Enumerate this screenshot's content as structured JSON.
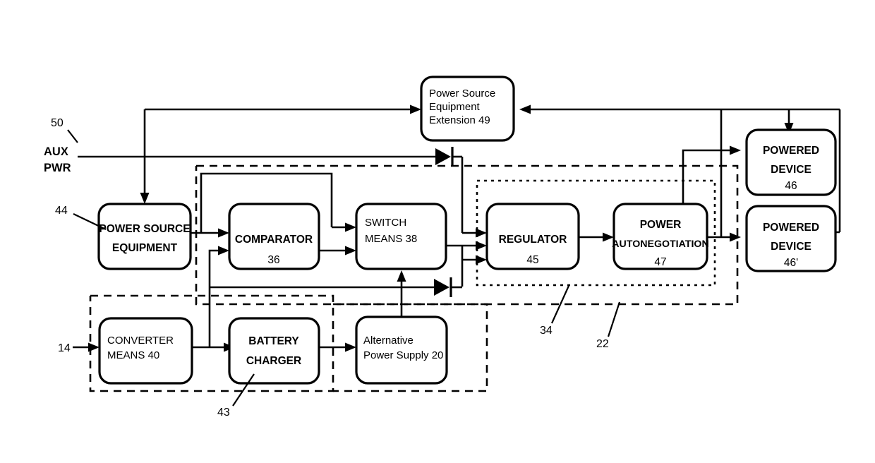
{
  "diagram": {
    "title": "Power over Ethernet power source equipment block diagram",
    "blocks": {
      "pse_extension": {
        "line1": "Power Source",
        "line2": "Equipment",
        "line3": "Extension 49"
      },
      "pse": {
        "line1": "POWER SOURCE",
        "line2": "EQUIPMENT"
      },
      "comparator": {
        "line1": "COMPARATOR",
        "line2": "36"
      },
      "switch_means": {
        "line1": "SWITCH",
        "line2": "MEANS 38"
      },
      "regulator": {
        "line1": "REGULATOR",
        "line2": "45"
      },
      "power_autonegotiation": {
        "line1": "POWER",
        "line2": "AUTONEGOTIATION",
        "line3": "47"
      },
      "powered_device_46": {
        "line1": "POWERED",
        "line2": "DEVICE",
        "line3": "46"
      },
      "powered_device_46p": {
        "line1": "POWERED",
        "line2": "DEVICE",
        "line3": "46'"
      },
      "converter_means": {
        "line1": "CONVERTER",
        "line2": "MEANS 40"
      },
      "battery_charger": {
        "line1": "BATTERY",
        "line2": "CHARGER"
      },
      "alternative_power_supply": {
        "line1": "Alternative",
        "line2": "Power Supply 20"
      }
    },
    "labels": {
      "aux_pwr_line1": "AUX",
      "aux_pwr_line2": "PWR",
      "ref_50": "50",
      "ref_44": "44",
      "ref_14": "14",
      "ref_43": "43",
      "ref_34": "34",
      "ref_22": "22"
    },
    "colors": {
      "ink": "#000000",
      "paper": "#ffffff"
    }
  }
}
